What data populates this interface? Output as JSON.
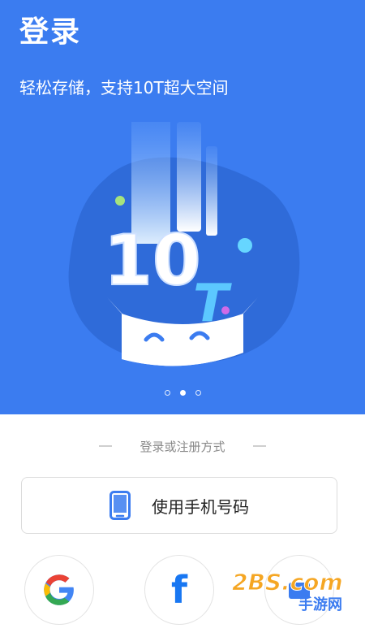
{
  "header": {
    "title": "登录",
    "subtitle": "轻松存储，支持10T超大空间"
  },
  "illustration": {
    "big_text": "10",
    "letter": "T"
  },
  "carousel": {
    "count": 3,
    "active_index": 1
  },
  "login": {
    "divider_text": "登录或注册方式",
    "phone_button_label": "使用手机号码",
    "social": [
      "google",
      "facebook",
      "other"
    ]
  },
  "watermark": {
    "text": "2BS.com",
    "sub": "手游网"
  },
  "colors": {
    "primary": "#3b7cf0",
    "blob": "#2f6bd9",
    "facebook": "#1877f2"
  }
}
